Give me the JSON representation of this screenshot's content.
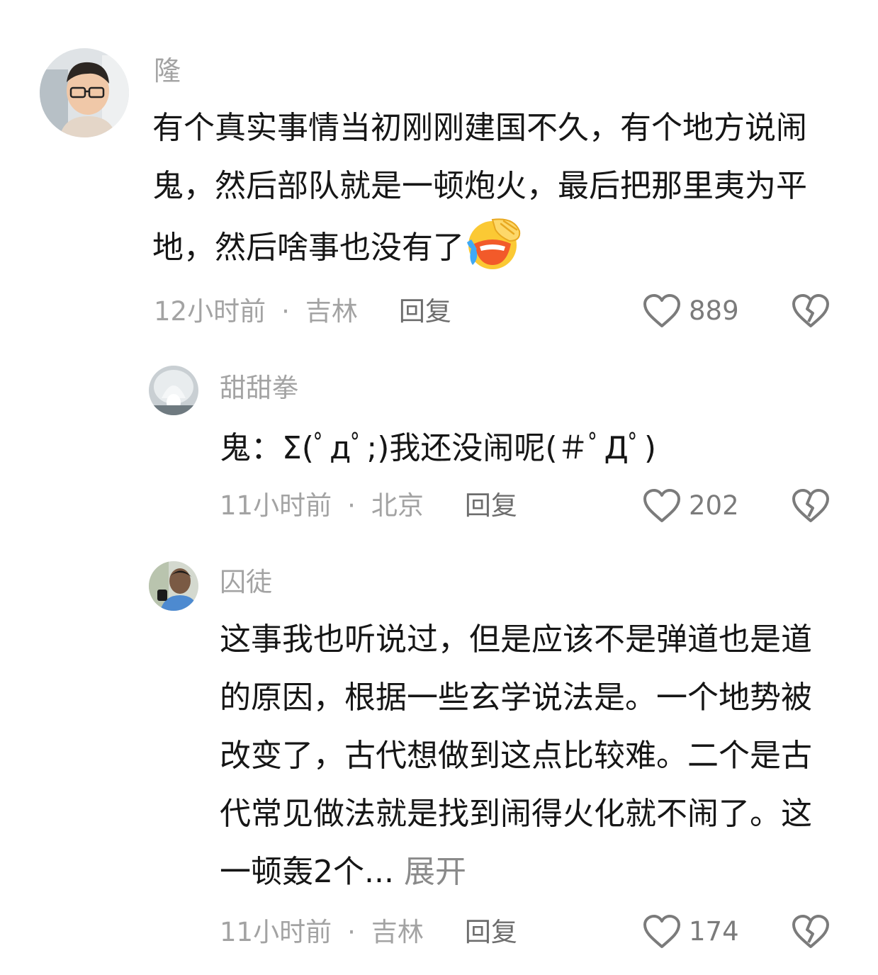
{
  "comments": [
    {
      "username": "隆",
      "text": "有个真实事情当初刚刚建国不久，有个地方说闹鬼，然后部队就是一顿炮火，最后把那里夷为平地，然后啥事也没有了",
      "emoji": "crying-laughing-emoji",
      "time": "12小时前",
      "separator": "·",
      "location": "吉林",
      "reply_label": "回复",
      "likes": "889"
    },
    {
      "username": "甜甜拳",
      "text": "鬼：Σ(ﾟдﾟ;)我还没闹呢(＃ﾟДﾟ)",
      "time": "11小时前",
      "separator": "·",
      "location": "北京",
      "reply_label": "回复",
      "likes": "202"
    },
    {
      "username": "囚徒",
      "text": "这事我也听说过，但是应该不是弹道也是道的原因，根据一些玄学说法是。一个地势被改变了，古代想做到这点比较难。二个是古代常见做法就是找到闹得火化就不闹了。这一顿轰2个...",
      "expand_label": "展开",
      "time": "11小时前",
      "separator": "·",
      "location": "吉林",
      "reply_label": "回复",
      "likes": "174"
    }
  ],
  "icons": {
    "like": "heart-outline-icon",
    "dislike": "broken-heart-icon"
  },
  "colors": {
    "meta_text": "#a3a3a3",
    "body_text": "#161616",
    "icon": "#7b7b7b"
  }
}
